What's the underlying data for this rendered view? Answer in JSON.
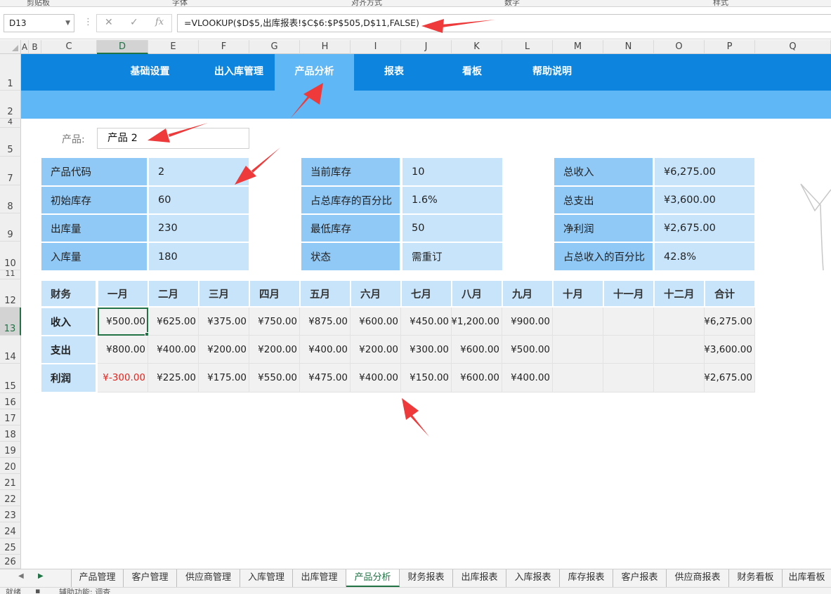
{
  "ribbon": {
    "groups": [
      "剪贴板",
      "字体",
      "对齐方式",
      "数字",
      "样式"
    ]
  },
  "formula_bar": {
    "name_box": "D13",
    "cancel_icon": "✕",
    "enter_icon": "✓",
    "fx_label": "fx",
    "formula": "=VLOOKUP($D$5,出库报表!$C$6:$P$505,D$11,FALSE)"
  },
  "columns": [
    "A",
    "B",
    "C",
    "D",
    "E",
    "F",
    "G",
    "H",
    "I",
    "J",
    "K",
    "L",
    "M",
    "N",
    "O",
    "P",
    "Q"
  ],
  "rows": [
    "1",
    "2",
    "4",
    "5",
    "7",
    "8",
    "9",
    "10",
    "11",
    "12",
    "13",
    "14",
    "15",
    "16",
    "17",
    "18",
    "19",
    "20",
    "21",
    "22",
    "23",
    "24",
    "25",
    "26"
  ],
  "nav": {
    "items": [
      "基础设置",
      "出入库管理",
      "产品分析",
      "报表",
      "看板",
      "帮助说明"
    ],
    "active": "产品分析"
  },
  "product": {
    "label": "产品:",
    "value": "产品 2"
  },
  "info_left": [
    {
      "label": "产品代码",
      "value": "2"
    },
    {
      "label": "初始库存",
      "value": "60"
    },
    {
      "label": "出库量",
      "value": "230"
    },
    {
      "label": "入库量",
      "value": "180"
    }
  ],
  "info_mid": [
    {
      "label": "当前库存",
      "value": "10"
    },
    {
      "label": "占总库存的百分比",
      "value": "1.6%"
    },
    {
      "label": "最低库存",
      "value": "50"
    },
    {
      "label": "状态",
      "value": "需重订"
    }
  ],
  "info_right": [
    {
      "label": "总收入",
      "value": "¥6,275.00"
    },
    {
      "label": "总支出",
      "value": "¥3,600.00"
    },
    {
      "label": "净利润",
      "value": "¥2,675.00"
    },
    {
      "label": "占总收入的百分比",
      "value": "42.8%"
    }
  ],
  "finance_table": {
    "headers": [
      "财务",
      "一月",
      "二月",
      "三月",
      "四月",
      "五月",
      "六月",
      "七月",
      "八月",
      "九月",
      "十月",
      "十一月",
      "十二月",
      "合计"
    ],
    "rows": [
      {
        "label": "收入",
        "values": [
          "¥500.00",
          "¥625.00",
          "¥375.00",
          "¥750.00",
          "¥875.00",
          "¥600.00",
          "¥450.00",
          "¥1,200.00",
          "¥900.00",
          "",
          "",
          "",
          "¥6,275.00"
        ]
      },
      {
        "label": "支出",
        "values": [
          "¥800.00",
          "¥400.00",
          "¥200.00",
          "¥200.00",
          "¥400.00",
          "¥200.00",
          "¥300.00",
          "¥600.00",
          "¥500.00",
          "",
          "",
          "",
          "¥3,600.00"
        ]
      },
      {
        "label": "利润",
        "values": [
          "¥-300.00",
          "¥225.00",
          "¥175.00",
          "¥550.00",
          "¥475.00",
          "¥400.00",
          "¥150.00",
          "¥600.00",
          "¥400.00",
          "",
          "",
          "",
          "¥2,675.00"
        ]
      }
    ],
    "negative_color": "#e8231c"
  },
  "sheet_tabs": {
    "tabs": [
      "产品管理",
      "客户管理",
      "供应商管理",
      "入库管理",
      "出库管理",
      "产品分析",
      "财务报表",
      "出库报表",
      "入库报表",
      "库存报表",
      "客户报表",
      "供应商报表",
      "财务看板",
      "出库看板"
    ],
    "active": "产品分析"
  },
  "status": {
    "ready": "就绪",
    "accessibility": "辅助功能: 调查"
  },
  "colors": {
    "nav": "#0d84de",
    "nav_active": "#5fb7f6",
    "header_dark": "#90c8f6",
    "header_light": "#c7e4fb",
    "annotation_arrow": "#ee3a3a"
  }
}
